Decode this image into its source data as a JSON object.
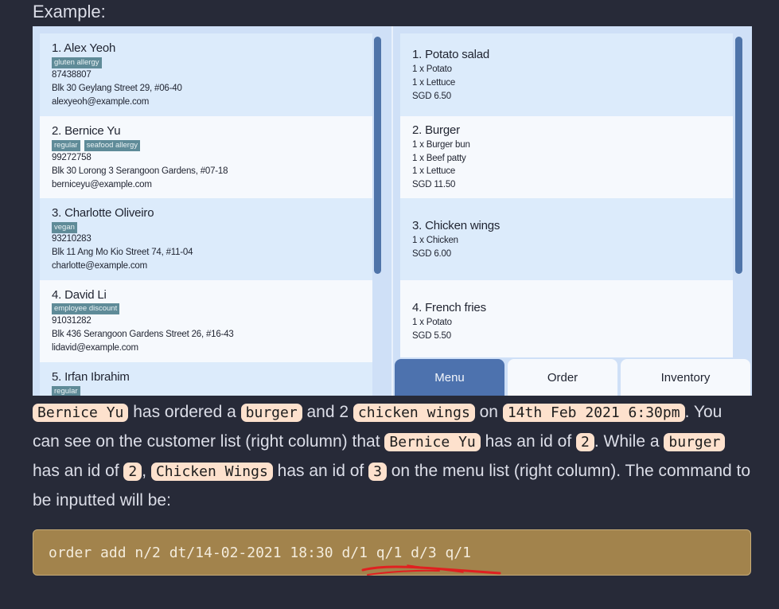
{
  "heading": "Example:",
  "customers": [
    {
      "title": "1. Alex Yeoh",
      "tags": [
        "gluten allergy"
      ],
      "phone": "87438807",
      "address": "Blk 30 Geylang Street 29, #06-40",
      "email": "alexyeoh@example.com"
    },
    {
      "title": "2. Bernice Yu",
      "tags": [
        "regular",
        "seafood allergy"
      ],
      "phone": "99272758",
      "address": "Blk 30 Lorong 3 Serangoon Gardens, #07-18",
      "email": "berniceyu@example.com"
    },
    {
      "title": "3. Charlotte Oliveiro",
      "tags": [
        "vegan"
      ],
      "phone": "93210283",
      "address": "Blk 11 Ang Mo Kio Street 74, #11-04",
      "email": "charlotte@example.com"
    },
    {
      "title": "4. David Li",
      "tags": [
        "employee discount"
      ],
      "phone": "91031282",
      "address": "Blk 436 Serangoon Gardens Street 26, #16-43",
      "email": "lidavid@example.com"
    },
    {
      "title": "5. Irfan Ibrahim",
      "tags": [
        "regular"
      ]
    }
  ],
  "menu": [
    {
      "title": "1. Potato salad",
      "lines": [
        "1 x Potato",
        "1 x Lettuce"
      ],
      "price": "SGD 6.50"
    },
    {
      "title": "2. Burger",
      "lines": [
        "1 x Burger bun",
        "1 x Beef patty",
        "1 x Lettuce"
      ],
      "price": "SGD 11.50"
    },
    {
      "title": "3. Chicken wings",
      "lines": [
        "1 x Chicken"
      ],
      "price": "SGD 6.00"
    },
    {
      "title": "4. French fries",
      "lines": [
        "1 x Potato"
      ],
      "price": "SGD 5.50"
    }
  ],
  "tabs": {
    "menu": "Menu",
    "order": "Order",
    "inventory": "Inventory"
  },
  "paragraph": {
    "p1": "Bernice Yu",
    "t1": " has ordered a ",
    "p2": "burger",
    "t2": " and 2 ",
    "p3": "chicken wings",
    "t3": " on ",
    "p4": "14th Feb 2021 6:30pm",
    "t4": ". You can see on the customer list (right column) that ",
    "p5": "Bernice Yu",
    "t5": " has an id of ",
    "p6": "2",
    "t6": ". While a ",
    "p7": "burger",
    "t7": " has an id of ",
    "p8": "2",
    "t8": ", ",
    "p9": "Chicken Wings",
    "t9": " has an id of ",
    "p10": "3",
    "t10": " on the menu list (right column). The command to be inputted will be:"
  },
  "command": "order add n/2 dt/14-02-2021 18:30 d/1 q/1 d/3 q/1",
  "colors": {
    "background": "#272a38",
    "highlight": "#fde1cd",
    "command_box": "#a2834c",
    "active_tab": "#4d72ae",
    "tag": "#5f8b98",
    "annotation": "#e02020"
  }
}
